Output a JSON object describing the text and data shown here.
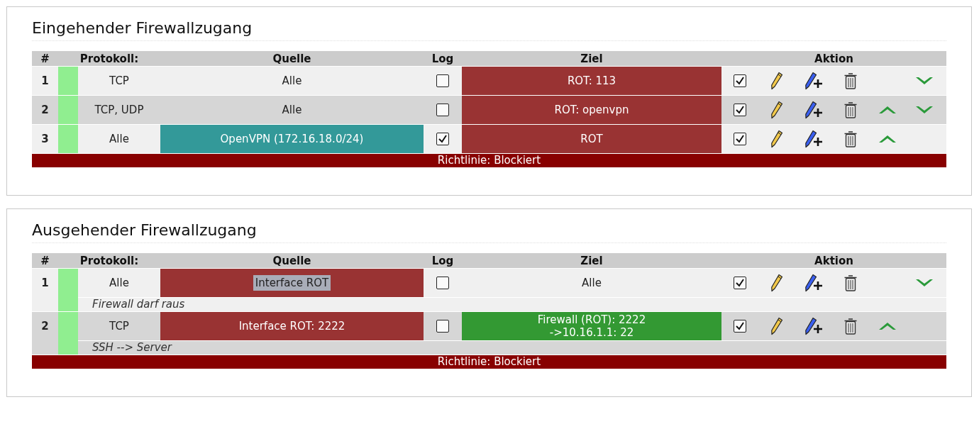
{
  "sections": [
    {
      "title": "Eingehender Firewallzugang",
      "columns": [
        "#",
        "Protokoll:",
        "Quelle",
        "Log",
        "Ziel",
        "Aktion"
      ],
      "rules": [
        {
          "number": "1",
          "color": "#90ee90",
          "protocol": "TCP",
          "source": {
            "text": "Alle",
            "highlighted": false
          },
          "log": false,
          "target": {
            "text": "ROT: 113",
            "color": "#993333",
            "highlighted": false
          },
          "enabled": true,
          "move_up": false,
          "move_down": true
        },
        {
          "number": "2",
          "color": "#90ee90",
          "protocol": "TCP, UDP",
          "source": {
            "text": "Alle",
            "highlighted": false
          },
          "log": false,
          "target": {
            "text": "ROT: openvpn",
            "color": "#993333",
            "highlighted": false
          },
          "enabled": true,
          "move_up": true,
          "move_down": true
        },
        {
          "number": "3",
          "color": "#90ee90",
          "protocol": "Alle",
          "source": {
            "text": "OpenVPN (172.16.18.0/24)",
            "color": "#339999",
            "highlighted": false
          },
          "log": true,
          "target": {
            "text": "ROT",
            "color": "#993333",
            "highlighted": false
          },
          "enabled": true,
          "move_up": true,
          "move_down": false
        }
      ],
      "policy": "Richtlinie: Blockiert"
    },
    {
      "title": "Ausgehender Firewallzugang",
      "columns": [
        "#",
        "Protokoll:",
        "Quelle",
        "Log",
        "Ziel",
        "Aktion"
      ],
      "rules": [
        {
          "number": "1",
          "color": "#90ee90",
          "protocol": "Alle",
          "source": {
            "text": "Interface ROT",
            "color": "#993333",
            "highlighted": true
          },
          "log": false,
          "target": {
            "text": "Alle",
            "highlighted": false
          },
          "enabled": true,
          "move_up": false,
          "move_down": true,
          "remark": "Firewall darf raus"
        },
        {
          "number": "2",
          "color": "#90ee90",
          "protocol": "TCP",
          "source": {
            "text": "Interface ROT: 2222",
            "color": "#993333",
            "highlighted": false
          },
          "log": false,
          "target": {
            "text": "Firewall (ROT): 2222\n->10.16.1.1: 22",
            "color": "#339933",
            "highlighted": false
          },
          "enabled": true,
          "move_up": true,
          "move_down": false,
          "remark": "SSH --> Server"
        }
      ],
      "policy": "Richtlinie: Blockiert"
    }
  ]
}
